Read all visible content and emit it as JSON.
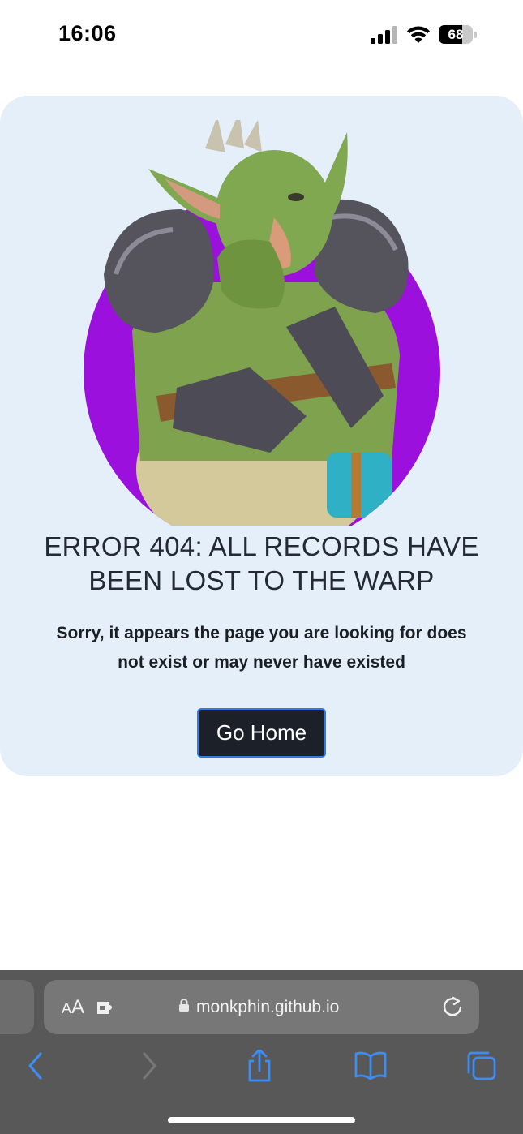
{
  "status_bar": {
    "time": "16:06",
    "battery_level": "68",
    "battery_fraction": 0.68
  },
  "page": {
    "headline_line1": "ERROR 404: ALL RECORDS HAVE",
    "headline_line2": "BEEN LOST TO THE WARP",
    "message_line1": "Sorry, it appears the page you are looking for does",
    "message_line2": "not exist or may never have existed",
    "home_button_label": "Go Home",
    "hero_image": "goblin-warrior-facepalm-illustration",
    "colors": {
      "card_background": "#e5effa",
      "hero_circle": "#9b10dd",
      "button_background": "#1b2029",
      "button_border": "#2e7be6"
    }
  },
  "browser": {
    "text_size_label_small": "A",
    "text_size_label_large": "A",
    "url": "monkphin.github.io",
    "toolbar": {
      "back_icon": "chevron-left-icon",
      "forward_icon": "chevron-right-icon",
      "share_icon": "share-icon",
      "bookmarks_icon": "book-icon",
      "tabs_icon": "tabs-icon"
    },
    "colors": {
      "toolbar_background": "#585858",
      "accent": "#3d8df5"
    }
  }
}
